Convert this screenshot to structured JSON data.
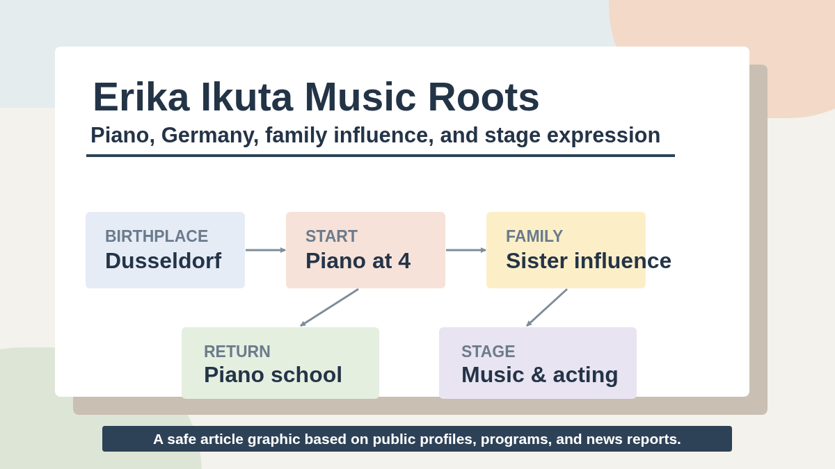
{
  "title": "Erika Ikuta Music Roots",
  "subtitle": "Piano, Germany, family influence, and stage expression",
  "nodes": [
    {
      "label": "BIRTHPLACE",
      "value": "Dusseldorf",
      "color": "#e6ecf6"
    },
    {
      "label": "START",
      "value": "Piano at 4",
      "color": "#f6e2d8"
    },
    {
      "label": "FAMILY",
      "value": "Sister influence",
      "color": "#fcefc8"
    },
    {
      "label": "RETURN",
      "value": "Piano school",
      "color": "#e4efe0"
    },
    {
      "label": "STAGE",
      "value": "Music & acting",
      "color": "#e8e4f2"
    }
  ],
  "footer": "A safe article graphic based on public profiles, programs, and news reports."
}
